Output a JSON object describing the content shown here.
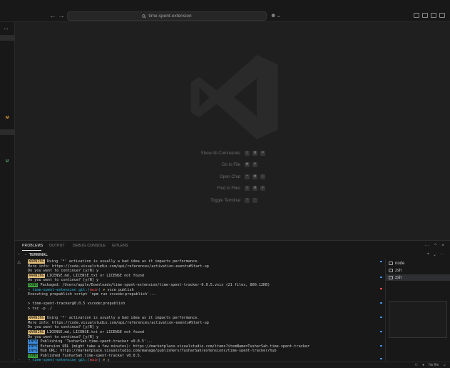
{
  "titlebar": {
    "back_icon": "arrow-left",
    "forward_icon": "arrow-right",
    "search_text": "time-spent-extension",
    "search_icon": "search-icon",
    "copilot_icon": "copilot-icon"
  },
  "activitybar": {
    "more": "···",
    "letters": [
      {
        "text": "M",
        "color": "#e2a33b"
      },
      {
        "text": "U",
        "color": "#73c991"
      }
    ]
  },
  "editor": {
    "shortcuts": [
      {
        "label": "Show All Commands",
        "keys": [
          "⇧",
          "⌘",
          "P"
        ]
      },
      {
        "label": "Go to File",
        "keys": [
          "⌘",
          "P"
        ]
      },
      {
        "label": "Open Chat",
        "keys": [
          "^",
          "⌘",
          "I"
        ]
      },
      {
        "label": "Find in Files",
        "keys": [
          "⇧",
          "⌘",
          "F"
        ]
      },
      {
        "label": "Toggle Terminal",
        "keys": [
          "^",
          "`"
        ]
      }
    ]
  },
  "panel": {
    "tabs": [
      "PROBLEMS",
      "OUTPUT",
      "DEBUG CONSOLE",
      "GITLENS"
    ],
    "active_tab": "PROBLEMS",
    "actions": [
      "···",
      "^",
      "×"
    ],
    "terminal_title": "TERMINAL",
    "terminal_actions": [
      "+",
      "⌄",
      "···"
    ]
  },
  "terminal": {
    "lines": [
      [
        {
          "badge": "warn",
          "text": "WARNING"
        },
        {
          "text": " Using '*' activation is usually a bad idea as it impacts performance."
        }
      ],
      [
        {
          "text": "More info: https://code.visualstudio.com/api/references/activation-events#Start-up"
        }
      ],
      [
        {
          "text": "Do you want to continue? [y/N] y"
        }
      ],
      [
        {
          "badge": "warn",
          "text": "WARNING"
        },
        {
          "text": " LICENSE.md, LICENSE.txt or LICENSE not found"
        }
      ],
      [
        {
          "text": "Do you want to continue? [y/N] y"
        }
      ],
      [
        {
          "badge": "done",
          "text": "DONE"
        },
        {
          "text": " Packaged: /Users/apple/Downloads/time-spent-extension/time-spent-tracker-0.0.5.vsix (21 files, 800.12KB)"
        }
      ],
      [
        {
          "style": "green",
          "text": "→ "
        },
        {
          "style": "cyan",
          "text": "time-spent-extension "
        },
        {
          "style": "cyan",
          "text": "git:("
        },
        {
          "style": "red",
          "text": "main"
        },
        {
          "style": "cyan",
          "text": ")"
        },
        {
          "style": "yellow",
          "text": " ✗ "
        },
        {
          "text": "vsce publish"
        }
      ],
      [
        {
          "text": "Executing prepublish script 'npm run vscode:prepublish'..."
        }
      ],
      [
        {
          "text": ""
        }
      ],
      [
        {
          "text": "> time-spent-tracker@0.0.5 vscode:prepublish"
        }
      ],
      [
        {
          "text": "> tsc -p ./"
        }
      ],
      [
        {
          "text": ""
        }
      ],
      [
        {
          "badge": "warn",
          "text": "WARNING"
        },
        {
          "text": " Using '*' activation is usually a bad idea as it impacts performance."
        }
      ],
      [
        {
          "text": "More info: https://code.visualstudio.com/api/references/activation-events#Start-up"
        }
      ],
      [
        {
          "text": "Do you want to continue? [y/N] y"
        }
      ],
      [
        {
          "badge": "warn",
          "text": "WARNING"
        },
        {
          "text": " LICENSE.md, LICENSE.txt or LICENSE not found"
        }
      ],
      [
        {
          "text": "Do you want to continue? [y/N] y"
        }
      ],
      [
        {
          "badge": "info",
          "text": "INFO"
        },
        {
          "text": " Publishing 'TusharSah.time-spent-tracker v0.0.5'..."
        }
      ],
      [
        {
          "badge": "info",
          "text": "INFO"
        },
        {
          "text": " Extension URL (might take a few minutes): https://marketplace.visualstudio.com/items?itemName=TusharSah.time-spent-tracker"
        }
      ],
      [
        {
          "badge": "info",
          "text": "INFO"
        },
        {
          "text": " Hub URL: https://marketplace.visualstudio.com/manage/publishers/TusharSah/extensions/time-spent-tracker/hub"
        }
      ],
      [
        {
          "badge": "done",
          "text": "DONE"
        },
        {
          "text": " Published TusharSah.time-spent-tracker v0.0.5."
        }
      ],
      [
        {
          "style": "green",
          "text": "→ "
        },
        {
          "style": "cyan",
          "text": "time-spent-extension "
        },
        {
          "style": "cyan",
          "text": "git:("
        },
        {
          "style": "red",
          "text": "main"
        },
        {
          "style": "cyan",
          "text": ")"
        },
        {
          "style": "yellow",
          "text": " ✗ "
        },
        {
          "text": "▯"
        }
      ]
    ]
  },
  "terminal_list": [
    {
      "name": "node",
      "selected": false
    },
    {
      "name": "zsh",
      "selected": false
    },
    {
      "name": "zsh",
      "selected": true
    }
  ],
  "statusbar": {
    "no_file": "No file"
  },
  "colors": {
    "warn_badge": "#e5c07b",
    "done_badge": "#3fa63f",
    "info_badge": "#3d8ee0",
    "prompt_arrow": "#23d18b",
    "prompt_dir": "#29b8db",
    "branch": "#f14c4c"
  }
}
